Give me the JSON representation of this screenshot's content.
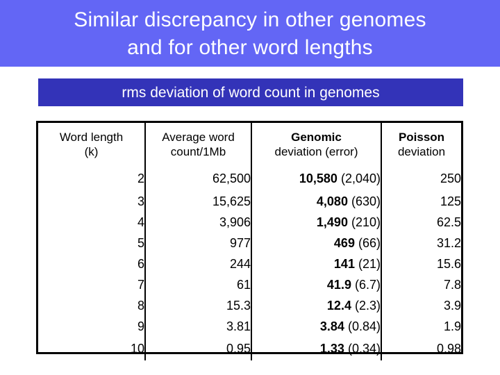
{
  "slide": {
    "title_lines": [
      "Similar discrepancy in other genomes",
      "and for other word lengths"
    ],
    "subtitle": "rms deviation of word count in genomes",
    "colors": {
      "title_banner_bg": "#6366F5",
      "title_text": "#FFFFFF",
      "subtitle_bar_bg": "#3333B8",
      "subtitle_text": "#FFFFFF",
      "table_border": "#000000",
      "table_bg": "#FFFFFF",
      "table_text": "#000000"
    }
  },
  "table": {
    "headers": [
      {
        "bold_line": "",
        "line1": "Word length",
        "line2": "(k)"
      },
      {
        "bold_line": "",
        "line1": "Average word",
        "line2": "count/1Mb"
      },
      {
        "bold_line": "Genomic",
        "line1": "",
        "line2": "deviation (error)"
      },
      {
        "bold_line": "Poisson",
        "line1": "",
        "line2": "deviation"
      }
    ],
    "rows": [
      {
        "k": "2",
        "avg": "62,500",
        "genomic": "10,580",
        "genomic_error": "(2,040)",
        "poisson": "250"
      },
      {
        "k": "3",
        "avg": "15,625",
        "genomic": "4,080",
        "genomic_error": "(630)",
        "poisson": "125"
      },
      {
        "k": "4",
        "avg": "3,906",
        "genomic": "1,490",
        "genomic_error": "(210)",
        "poisson": "62.5"
      },
      {
        "k": "5",
        "avg": "977",
        "genomic": "469",
        "genomic_error": "(66)",
        "poisson": "31.2"
      },
      {
        "k": "6",
        "avg": "244",
        "genomic": "141",
        "genomic_error": "(21)",
        "poisson": "15.6"
      },
      {
        "k": "7",
        "avg": "61",
        "genomic": "41.9",
        "genomic_error": "(6.7)",
        "poisson": "7.8"
      },
      {
        "k": "8",
        "avg": "15.3",
        "genomic": "12.4",
        "genomic_error": "(2.3)",
        "poisson": "3.9"
      },
      {
        "k": "9",
        "avg": "3.81",
        "genomic": "3.84",
        "genomic_error": "(0.84)",
        "poisson": "1.9"
      },
      {
        "k": "10",
        "avg": "0.95",
        "genomic": "1.33",
        "genomic_error": "(0.34)",
        "poisson": "0.98"
      }
    ]
  },
  "chart_data": {
    "type": "table",
    "title": "rms deviation of word count in genomes",
    "columns": [
      "Word length (k)",
      "Average word count/1Mb",
      "Genomic deviation (error)",
      "Poisson deviation"
    ],
    "categories": [
      "2",
      "3",
      "4",
      "5",
      "6",
      "7",
      "8",
      "9",
      "10"
    ],
    "series": [
      {
        "name": "Average word count/1Mb",
        "values": [
          62500,
          15625,
          3906,
          977,
          244,
          61,
          15.3,
          3.81,
          0.95
        ]
      },
      {
        "name": "Genomic deviation",
        "values": [
          10580,
          4080,
          1490,
          469,
          141,
          41.9,
          12.4,
          3.84,
          1.33
        ]
      },
      {
        "name": "Genomic deviation error",
        "values": [
          2040,
          630,
          210,
          66,
          21,
          6.7,
          2.3,
          0.84,
          0.34
        ]
      },
      {
        "name": "Poisson deviation",
        "values": [
          250,
          125,
          62.5,
          31.2,
          15.6,
          7.8,
          3.9,
          1.9,
          0.98
        ]
      }
    ],
    "xlabel": "Word length (k)",
    "ylabel": "Deviation"
  }
}
